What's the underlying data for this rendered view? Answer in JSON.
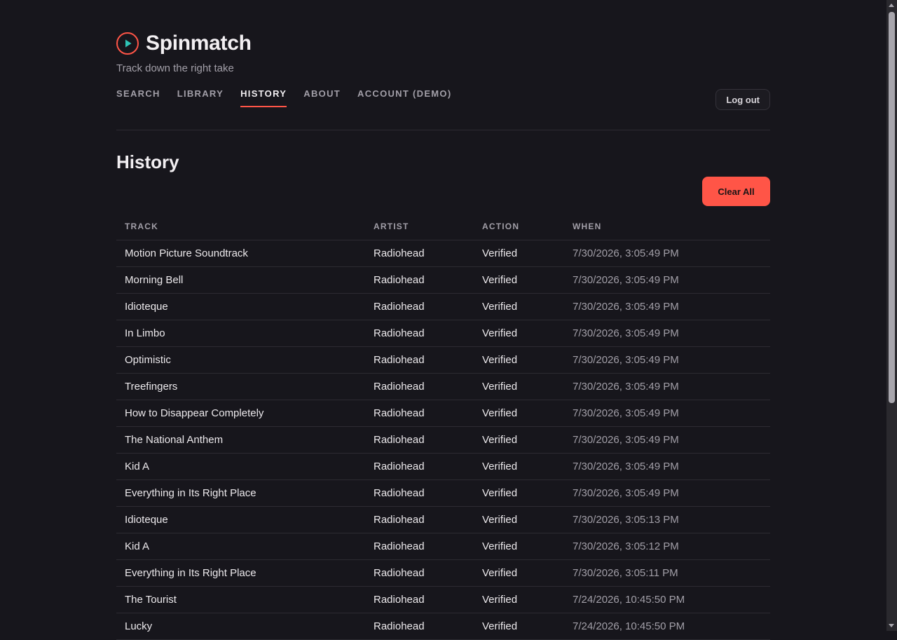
{
  "brand": {
    "name": "Spinmatch",
    "tagline": "Track down the right take",
    "logo_icon": "play-circle-icon",
    "accent": "#ff5547",
    "play_color": "#2ec4b6"
  },
  "nav": {
    "items": [
      {
        "label": "SEARCH",
        "active": false
      },
      {
        "label": "LIBRARY",
        "active": false
      },
      {
        "label": "HISTORY",
        "active": true
      },
      {
        "label": "ABOUT",
        "active": false
      },
      {
        "label": "ACCOUNT (DEMO)",
        "active": false
      }
    ],
    "logout_label": "Log out"
  },
  "main": {
    "title": "History",
    "clear_label": "Clear All",
    "table": {
      "columns": [
        "TRACK",
        "ARTIST",
        "ACTION",
        "WHEN"
      ],
      "rows": [
        {
          "track": "Motion Picture Soundtrack",
          "artist": "Radiohead",
          "action": "Verified",
          "when": "7/30/2026, 3:05:49 PM"
        },
        {
          "track": "Morning Bell",
          "artist": "Radiohead",
          "action": "Verified",
          "when": "7/30/2026, 3:05:49 PM"
        },
        {
          "track": "Idioteque",
          "artist": "Radiohead",
          "action": "Verified",
          "when": "7/30/2026, 3:05:49 PM"
        },
        {
          "track": "In Limbo",
          "artist": "Radiohead",
          "action": "Verified",
          "when": "7/30/2026, 3:05:49 PM"
        },
        {
          "track": "Optimistic",
          "artist": "Radiohead",
          "action": "Verified",
          "when": "7/30/2026, 3:05:49 PM"
        },
        {
          "track": "Treefingers",
          "artist": "Radiohead",
          "action": "Verified",
          "when": "7/30/2026, 3:05:49 PM"
        },
        {
          "track": "How to Disappear Completely",
          "artist": "Radiohead",
          "action": "Verified",
          "when": "7/30/2026, 3:05:49 PM"
        },
        {
          "track": "The National Anthem",
          "artist": "Radiohead",
          "action": "Verified",
          "when": "7/30/2026, 3:05:49 PM"
        },
        {
          "track": "Kid A",
          "artist": "Radiohead",
          "action": "Verified",
          "when": "7/30/2026, 3:05:49 PM"
        },
        {
          "track": "Everything in Its Right Place",
          "artist": "Radiohead",
          "action": "Verified",
          "when": "7/30/2026, 3:05:49 PM"
        },
        {
          "track": "Idioteque",
          "artist": "Radiohead",
          "action": "Verified",
          "when": "7/30/2026, 3:05:13 PM"
        },
        {
          "track": "Kid A",
          "artist": "Radiohead",
          "action": "Verified",
          "when": "7/30/2026, 3:05:12 PM"
        },
        {
          "track": "Everything in Its Right Place",
          "artist": "Radiohead",
          "action": "Verified",
          "when": "7/30/2026, 3:05:11 PM"
        },
        {
          "track": "The Tourist",
          "artist": "Radiohead",
          "action": "Verified",
          "when": "7/24/2026, 10:45:50 PM"
        },
        {
          "track": "Lucky",
          "artist": "Radiohead",
          "action": "Verified",
          "when": "7/24/2026, 10:45:50 PM"
        }
      ]
    }
  }
}
